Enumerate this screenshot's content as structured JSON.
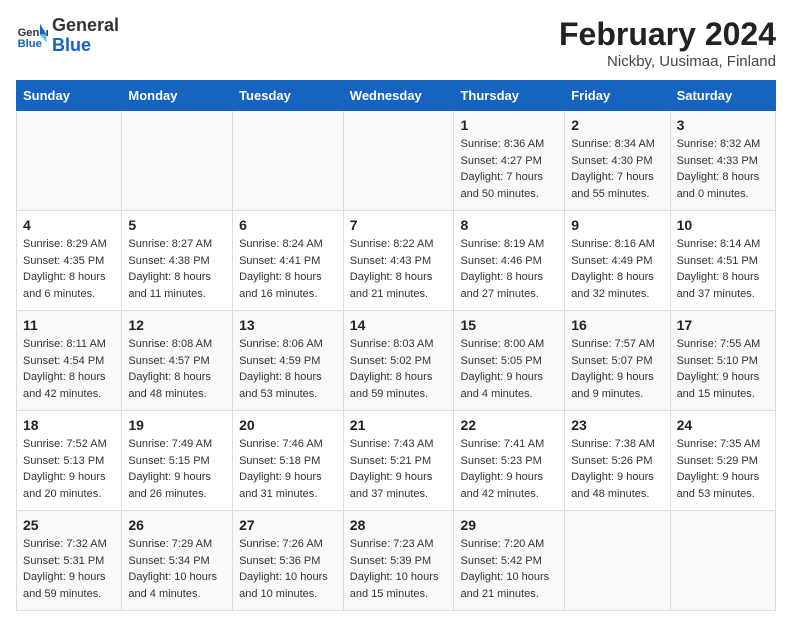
{
  "logo": {
    "text_general": "General",
    "text_blue": "Blue"
  },
  "title": "February 2024",
  "subtitle": "Nickby, Uusimaa, Finland",
  "days_of_week": [
    "Sunday",
    "Monday",
    "Tuesday",
    "Wednesday",
    "Thursday",
    "Friday",
    "Saturday"
  ],
  "weeks": [
    [
      {
        "day": "",
        "info": ""
      },
      {
        "day": "",
        "info": ""
      },
      {
        "day": "",
        "info": ""
      },
      {
        "day": "",
        "info": ""
      },
      {
        "day": "1",
        "info": "Sunrise: 8:36 AM\nSunset: 4:27 PM\nDaylight: 7 hours\nand 50 minutes."
      },
      {
        "day": "2",
        "info": "Sunrise: 8:34 AM\nSunset: 4:30 PM\nDaylight: 7 hours\nand 55 minutes."
      },
      {
        "day": "3",
        "info": "Sunrise: 8:32 AM\nSunset: 4:33 PM\nDaylight: 8 hours\nand 0 minutes."
      }
    ],
    [
      {
        "day": "4",
        "info": "Sunrise: 8:29 AM\nSunset: 4:35 PM\nDaylight: 8 hours\nand 6 minutes."
      },
      {
        "day": "5",
        "info": "Sunrise: 8:27 AM\nSunset: 4:38 PM\nDaylight: 8 hours\nand 11 minutes."
      },
      {
        "day": "6",
        "info": "Sunrise: 8:24 AM\nSunset: 4:41 PM\nDaylight: 8 hours\nand 16 minutes."
      },
      {
        "day": "7",
        "info": "Sunrise: 8:22 AM\nSunset: 4:43 PM\nDaylight: 8 hours\nand 21 minutes."
      },
      {
        "day": "8",
        "info": "Sunrise: 8:19 AM\nSunset: 4:46 PM\nDaylight: 8 hours\nand 27 minutes."
      },
      {
        "day": "9",
        "info": "Sunrise: 8:16 AM\nSunset: 4:49 PM\nDaylight: 8 hours\nand 32 minutes."
      },
      {
        "day": "10",
        "info": "Sunrise: 8:14 AM\nSunset: 4:51 PM\nDaylight: 8 hours\nand 37 minutes."
      }
    ],
    [
      {
        "day": "11",
        "info": "Sunrise: 8:11 AM\nSunset: 4:54 PM\nDaylight: 8 hours\nand 42 minutes."
      },
      {
        "day": "12",
        "info": "Sunrise: 8:08 AM\nSunset: 4:57 PM\nDaylight: 8 hours\nand 48 minutes."
      },
      {
        "day": "13",
        "info": "Sunrise: 8:06 AM\nSunset: 4:59 PM\nDaylight: 8 hours\nand 53 minutes."
      },
      {
        "day": "14",
        "info": "Sunrise: 8:03 AM\nSunset: 5:02 PM\nDaylight: 8 hours\nand 59 minutes."
      },
      {
        "day": "15",
        "info": "Sunrise: 8:00 AM\nSunset: 5:05 PM\nDaylight: 9 hours\nand 4 minutes."
      },
      {
        "day": "16",
        "info": "Sunrise: 7:57 AM\nSunset: 5:07 PM\nDaylight: 9 hours\nand 9 minutes."
      },
      {
        "day": "17",
        "info": "Sunrise: 7:55 AM\nSunset: 5:10 PM\nDaylight: 9 hours\nand 15 minutes."
      }
    ],
    [
      {
        "day": "18",
        "info": "Sunrise: 7:52 AM\nSunset: 5:13 PM\nDaylight: 9 hours\nand 20 minutes."
      },
      {
        "day": "19",
        "info": "Sunrise: 7:49 AM\nSunset: 5:15 PM\nDaylight: 9 hours\nand 26 minutes."
      },
      {
        "day": "20",
        "info": "Sunrise: 7:46 AM\nSunset: 5:18 PM\nDaylight: 9 hours\nand 31 minutes."
      },
      {
        "day": "21",
        "info": "Sunrise: 7:43 AM\nSunset: 5:21 PM\nDaylight: 9 hours\nand 37 minutes."
      },
      {
        "day": "22",
        "info": "Sunrise: 7:41 AM\nSunset: 5:23 PM\nDaylight: 9 hours\nand 42 minutes."
      },
      {
        "day": "23",
        "info": "Sunrise: 7:38 AM\nSunset: 5:26 PM\nDaylight: 9 hours\nand 48 minutes."
      },
      {
        "day": "24",
        "info": "Sunrise: 7:35 AM\nSunset: 5:29 PM\nDaylight: 9 hours\nand 53 minutes."
      }
    ],
    [
      {
        "day": "25",
        "info": "Sunrise: 7:32 AM\nSunset: 5:31 PM\nDaylight: 9 hours\nand 59 minutes."
      },
      {
        "day": "26",
        "info": "Sunrise: 7:29 AM\nSunset: 5:34 PM\nDaylight: 10 hours\nand 4 minutes."
      },
      {
        "day": "27",
        "info": "Sunrise: 7:26 AM\nSunset: 5:36 PM\nDaylight: 10 hours\nand 10 minutes."
      },
      {
        "day": "28",
        "info": "Sunrise: 7:23 AM\nSunset: 5:39 PM\nDaylight: 10 hours\nand 15 minutes."
      },
      {
        "day": "29",
        "info": "Sunrise: 7:20 AM\nSunset: 5:42 PM\nDaylight: 10 hours\nand 21 minutes."
      },
      {
        "day": "",
        "info": ""
      },
      {
        "day": "",
        "info": ""
      }
    ]
  ]
}
